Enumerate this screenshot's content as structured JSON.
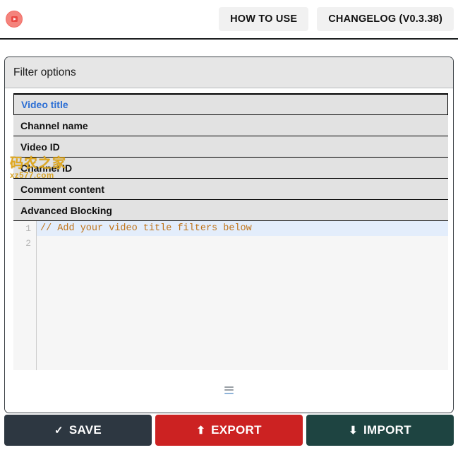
{
  "header": {
    "logo_icon": "youtube-play-circle-icon",
    "buttons": [
      {
        "id": "how-to-use",
        "label": "HOW TO USE"
      },
      {
        "id": "changelog",
        "label": "CHANGELOG (V0.3.38)"
      }
    ]
  },
  "card": {
    "title": "Filter options",
    "filters": [
      {
        "id": "video-title",
        "label": "Video title",
        "active": true
      },
      {
        "id": "channel-name",
        "label": "Channel name",
        "active": false
      },
      {
        "id": "video-id",
        "label": "Video ID",
        "active": false
      },
      {
        "id": "channel-id",
        "label": "Channel ID",
        "active": false
      },
      {
        "id": "comment-content",
        "label": "Comment content",
        "active": false
      },
      {
        "id": "advanced-blocking",
        "label": "Advanced Blocking",
        "active": false
      }
    ],
    "editor": {
      "line_numbers": [
        "1",
        "2"
      ],
      "lines": [
        {
          "number": "1",
          "text": "// Add your video title filters below",
          "active": true
        },
        {
          "number": "2",
          "text": "",
          "active": false
        }
      ],
      "comment_color": "#c07318",
      "active_line_color": "#e3edfb"
    },
    "resize_handle_icon": "drag-handle-icon"
  },
  "footer": {
    "buttons": [
      {
        "id": "save",
        "label": "SAVE",
        "glyph": "✓",
        "icon": "check-icon",
        "color": "#2d3741"
      },
      {
        "id": "export",
        "label": "EXPORT",
        "glyph": "⬆",
        "icon": "arrow-up-icon",
        "color": "#cc2222"
      },
      {
        "id": "import",
        "label": "IMPORT",
        "glyph": "⬇",
        "icon": "arrow-down-icon",
        "color": "#1e4441"
      }
    ]
  },
  "watermark": {
    "line1": "码农之家",
    "line2": "xz577.com"
  }
}
